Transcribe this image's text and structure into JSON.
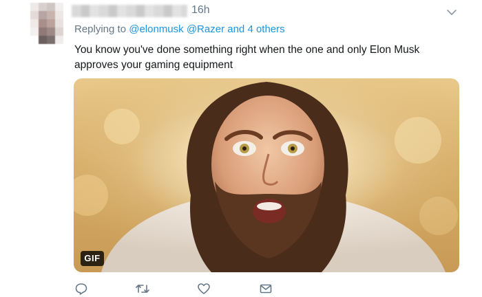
{
  "tweet": {
    "timestamp": "16h",
    "replying": {
      "prefix": "Replying to",
      "mention_1": "@elonmusk",
      "mention_2": "@Razer",
      "suffix": "and 4 others"
    },
    "text": "You know you've done something right when the one and only Elon Musk approves your gaming equipment",
    "media": {
      "badge": "GIF"
    },
    "actions": {
      "reply_icon": "reply-icon",
      "retweet_icon": "retweet-icon",
      "like_icon": "heart-icon",
      "dm_icon": "envelope-icon"
    }
  },
  "colors": {
    "link": "#1b95e0",
    "secondary_text": "#657786",
    "primary_text": "#14171a",
    "action_icon": "#657786"
  }
}
